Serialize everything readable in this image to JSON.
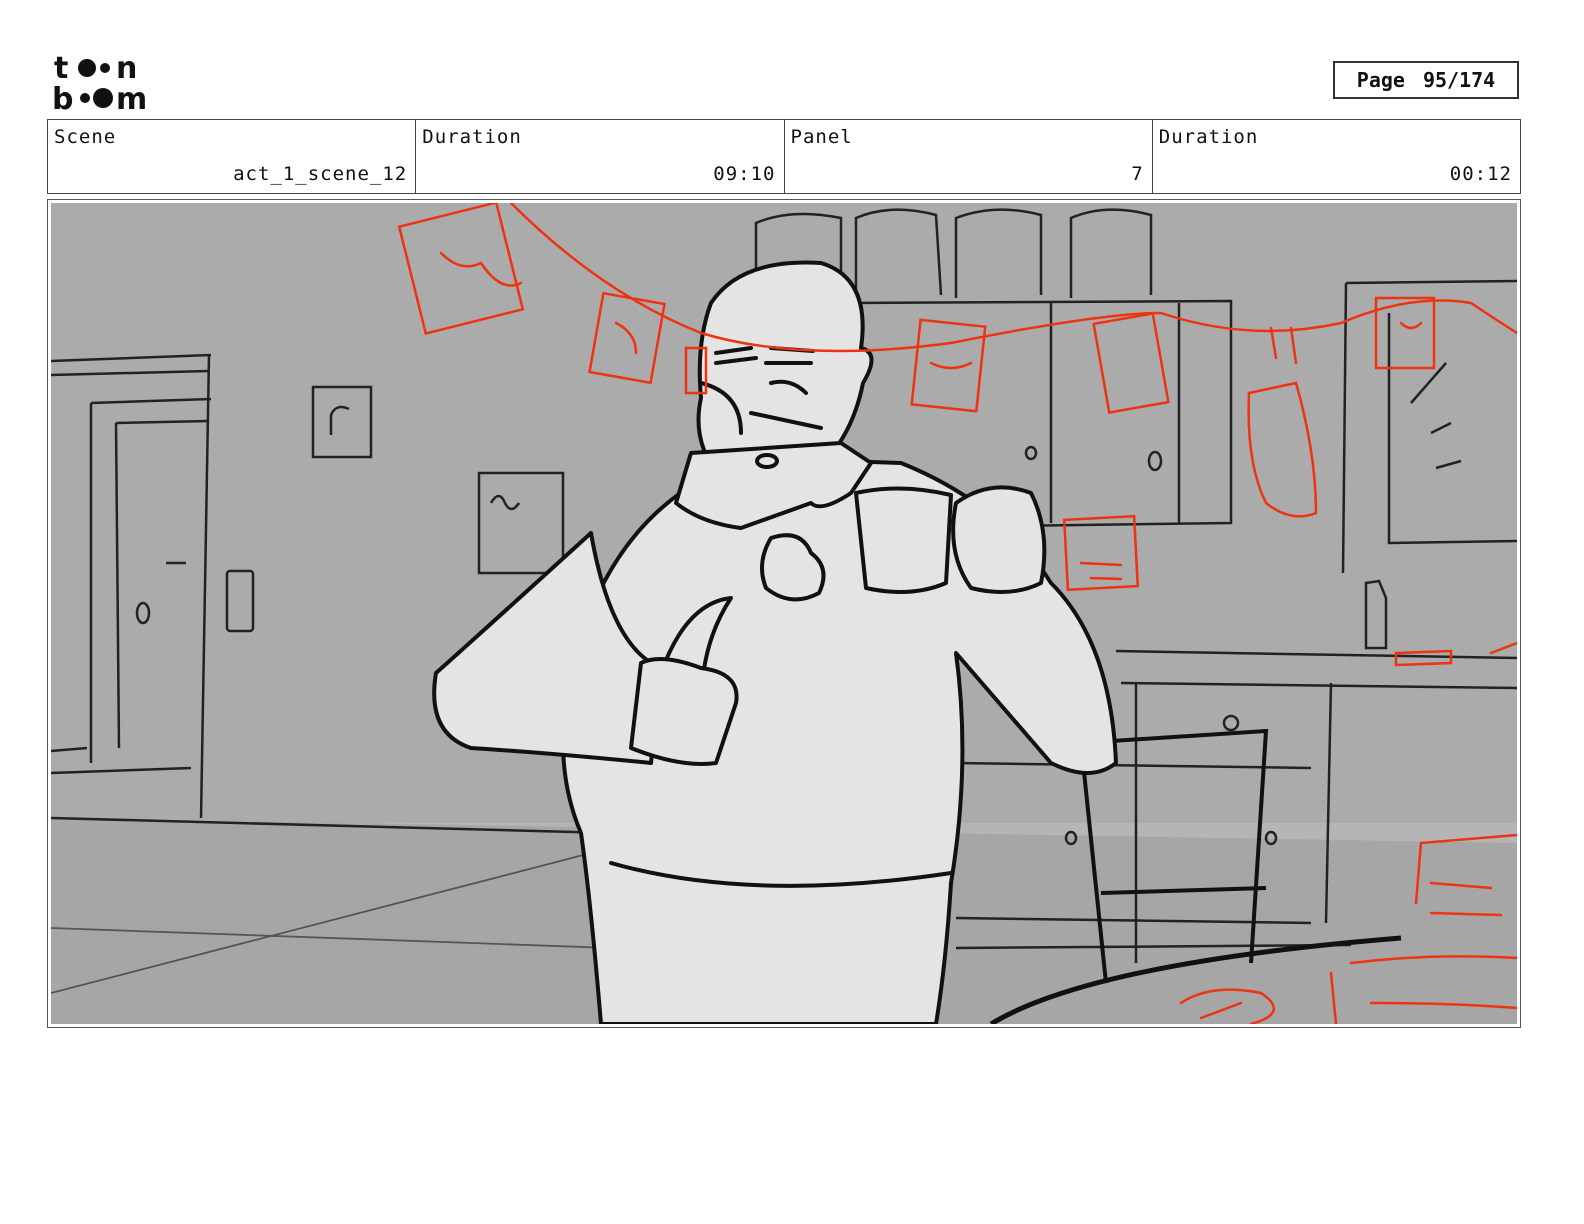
{
  "brand": {
    "logo_line1": "toon",
    "logo_line2": "boom"
  },
  "page": {
    "label": "Page",
    "value": "95/174"
  },
  "info": {
    "scene_label": "Scene",
    "scene_value": "act_1_scene_12",
    "scene_duration_label": "Duration",
    "scene_duration_value": "09:10",
    "panel_label": "Panel",
    "panel_value": "7",
    "panel_duration_label": "Duration",
    "panel_duration_value": "00:12"
  },
  "panel": {
    "description": "storyboard sketch",
    "colors": {
      "background": "#b3b3b3",
      "wall": "#a9a9a9",
      "character_fill": "#e4e4e4",
      "line": "#111111",
      "red_sketch": "#ee3311"
    }
  }
}
